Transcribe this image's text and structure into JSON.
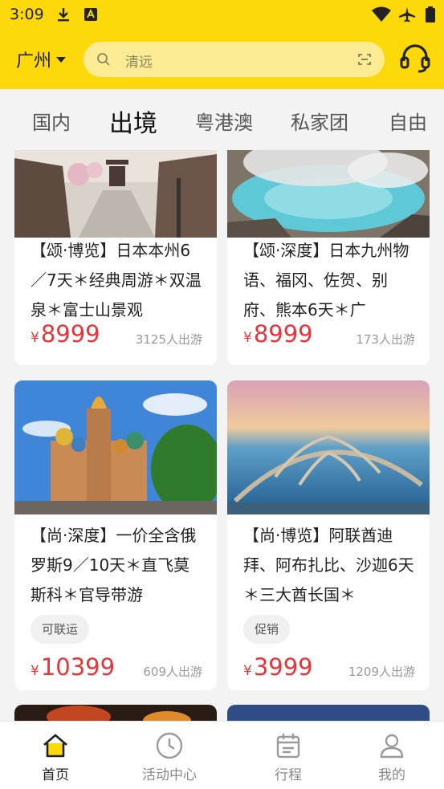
{
  "status": {
    "time": "3:09"
  },
  "header": {
    "city": "广州",
    "search_placeholder": "清远"
  },
  "tabs": [
    {
      "label": "国内",
      "active": false
    },
    {
      "label": "出境",
      "active": true
    },
    {
      "label": "粤港澳",
      "active": false
    },
    {
      "label": "私家团",
      "active": false
    },
    {
      "label": "自由",
      "active": false
    }
  ],
  "cards": [
    {
      "title": "【颂·博览】日本本州6／7天＊经典周游＊双温泉＊富士山景观",
      "currency": "¥",
      "price": "8999",
      "sold": "3125人出游",
      "tag": ""
    },
    {
      "title": "【颂·深度】日本九州物语、福冈、佐贺、别府、熊本6天＊广",
      "currency": "¥",
      "price": "8999",
      "sold": "173人出游",
      "tag": ""
    },
    {
      "title": "【尚·深度】一价全含俄罗斯9／10天＊直飞莫斯科＊官导带游",
      "currency": "¥",
      "price": "10399",
      "sold": "609人出游",
      "tag": "可联运"
    },
    {
      "title": "【尚·博览】阿联酋迪拜、阿布扎比、沙迦6天＊三大酋长国＊",
      "currency": "¥",
      "price": "3999",
      "sold": "1209人出游",
      "tag": "促销"
    }
  ],
  "bottom_nav": [
    {
      "label": "首页",
      "icon": "home-icon",
      "active": true
    },
    {
      "label": "活动中心",
      "icon": "clock-icon",
      "active": false
    },
    {
      "label": "行程",
      "icon": "calendar-icon",
      "active": false
    },
    {
      "label": "我的",
      "icon": "user-icon",
      "active": false
    }
  ],
  "colors": {
    "brand_yellow": "#fdd90c",
    "price_red": "#e8343a"
  }
}
